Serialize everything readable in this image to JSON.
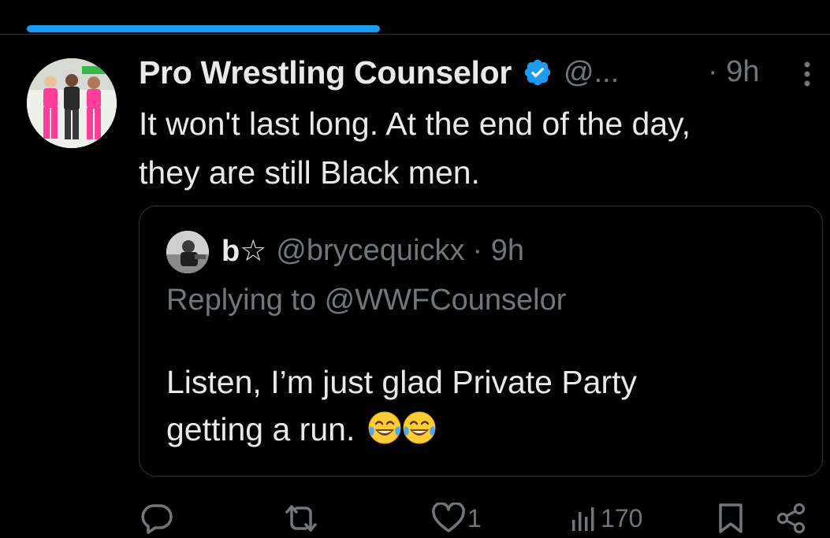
{
  "post": {
    "author_name": "Pro Wrestling Counselor",
    "author_handle": "@...",
    "time": "· 9h",
    "text_line1": "It won't last long. At the end of the day,",
    "text_line2": "they are still Black men."
  },
  "quote": {
    "author_name": "b☆",
    "author_handle": "@brycequickx",
    "time": "· 9h",
    "replying_to": "Replying to @WWFCounselor",
    "text_line1": "Listen, I’m just glad Private Party",
    "text_line2": "getting a run."
  },
  "actions": {
    "like_count": "1",
    "view_count": "170"
  },
  "icons": {
    "verified": "verified-badge-icon",
    "more": "more-vertical-icon",
    "reply": "reply-icon",
    "repost": "repost-icon",
    "like": "heart-icon",
    "views": "views-chart-icon",
    "bookmark": "bookmark-icon",
    "share": "share-icon",
    "emoji": "face-with-tears-of-joy-emoji"
  },
  "colors": {
    "accent": "#1d9bf0",
    "background": "#000000",
    "text": "#e7e9ea",
    "muted": "#71767b",
    "border": "#2f3336"
  }
}
